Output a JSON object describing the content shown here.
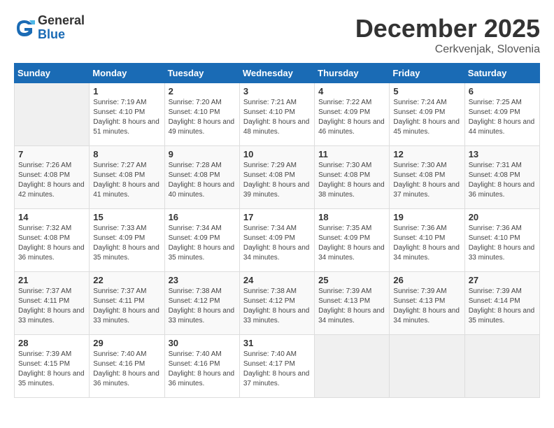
{
  "header": {
    "logo_general": "General",
    "logo_blue": "Blue",
    "month_title": "December 2025",
    "location": "Cerkvenjak, Slovenia"
  },
  "columns": [
    "Sunday",
    "Monday",
    "Tuesday",
    "Wednesday",
    "Thursday",
    "Friday",
    "Saturday"
  ],
  "weeks": [
    [
      {
        "day": "",
        "sunrise": "",
        "sunset": "",
        "daylight": ""
      },
      {
        "day": "1",
        "sunrise": "Sunrise: 7:19 AM",
        "sunset": "Sunset: 4:10 PM",
        "daylight": "Daylight: 8 hours and 51 minutes."
      },
      {
        "day": "2",
        "sunrise": "Sunrise: 7:20 AM",
        "sunset": "Sunset: 4:10 PM",
        "daylight": "Daylight: 8 hours and 49 minutes."
      },
      {
        "day": "3",
        "sunrise": "Sunrise: 7:21 AM",
        "sunset": "Sunset: 4:10 PM",
        "daylight": "Daylight: 8 hours and 48 minutes."
      },
      {
        "day": "4",
        "sunrise": "Sunrise: 7:22 AM",
        "sunset": "Sunset: 4:09 PM",
        "daylight": "Daylight: 8 hours and 46 minutes."
      },
      {
        "day": "5",
        "sunrise": "Sunrise: 7:24 AM",
        "sunset": "Sunset: 4:09 PM",
        "daylight": "Daylight: 8 hours and 45 minutes."
      },
      {
        "day": "6",
        "sunrise": "Sunrise: 7:25 AM",
        "sunset": "Sunset: 4:09 PM",
        "daylight": "Daylight: 8 hours and 44 minutes."
      }
    ],
    [
      {
        "day": "7",
        "sunrise": "Sunrise: 7:26 AM",
        "sunset": "Sunset: 4:08 PM",
        "daylight": "Daylight: 8 hours and 42 minutes."
      },
      {
        "day": "8",
        "sunrise": "Sunrise: 7:27 AM",
        "sunset": "Sunset: 4:08 PM",
        "daylight": "Daylight: 8 hours and 41 minutes."
      },
      {
        "day": "9",
        "sunrise": "Sunrise: 7:28 AM",
        "sunset": "Sunset: 4:08 PM",
        "daylight": "Daylight: 8 hours and 40 minutes."
      },
      {
        "day": "10",
        "sunrise": "Sunrise: 7:29 AM",
        "sunset": "Sunset: 4:08 PM",
        "daylight": "Daylight: 8 hours and 39 minutes."
      },
      {
        "day": "11",
        "sunrise": "Sunrise: 7:30 AM",
        "sunset": "Sunset: 4:08 PM",
        "daylight": "Daylight: 8 hours and 38 minutes."
      },
      {
        "day": "12",
        "sunrise": "Sunrise: 7:30 AM",
        "sunset": "Sunset: 4:08 PM",
        "daylight": "Daylight: 8 hours and 37 minutes."
      },
      {
        "day": "13",
        "sunrise": "Sunrise: 7:31 AM",
        "sunset": "Sunset: 4:08 PM",
        "daylight": "Daylight: 8 hours and 36 minutes."
      }
    ],
    [
      {
        "day": "14",
        "sunrise": "Sunrise: 7:32 AM",
        "sunset": "Sunset: 4:08 PM",
        "daylight": "Daylight: 8 hours and 36 minutes."
      },
      {
        "day": "15",
        "sunrise": "Sunrise: 7:33 AM",
        "sunset": "Sunset: 4:09 PM",
        "daylight": "Daylight: 8 hours and 35 minutes."
      },
      {
        "day": "16",
        "sunrise": "Sunrise: 7:34 AM",
        "sunset": "Sunset: 4:09 PM",
        "daylight": "Daylight: 8 hours and 35 minutes."
      },
      {
        "day": "17",
        "sunrise": "Sunrise: 7:34 AM",
        "sunset": "Sunset: 4:09 PM",
        "daylight": "Daylight: 8 hours and 34 minutes."
      },
      {
        "day": "18",
        "sunrise": "Sunrise: 7:35 AM",
        "sunset": "Sunset: 4:09 PM",
        "daylight": "Daylight: 8 hours and 34 minutes."
      },
      {
        "day": "19",
        "sunrise": "Sunrise: 7:36 AM",
        "sunset": "Sunset: 4:10 PM",
        "daylight": "Daylight: 8 hours and 34 minutes."
      },
      {
        "day": "20",
        "sunrise": "Sunrise: 7:36 AM",
        "sunset": "Sunset: 4:10 PM",
        "daylight": "Daylight: 8 hours and 33 minutes."
      }
    ],
    [
      {
        "day": "21",
        "sunrise": "Sunrise: 7:37 AM",
        "sunset": "Sunset: 4:11 PM",
        "daylight": "Daylight: 8 hours and 33 minutes."
      },
      {
        "day": "22",
        "sunrise": "Sunrise: 7:37 AM",
        "sunset": "Sunset: 4:11 PM",
        "daylight": "Daylight: 8 hours and 33 minutes."
      },
      {
        "day": "23",
        "sunrise": "Sunrise: 7:38 AM",
        "sunset": "Sunset: 4:12 PM",
        "daylight": "Daylight: 8 hours and 33 minutes."
      },
      {
        "day": "24",
        "sunrise": "Sunrise: 7:38 AM",
        "sunset": "Sunset: 4:12 PM",
        "daylight": "Daylight: 8 hours and 33 minutes."
      },
      {
        "day": "25",
        "sunrise": "Sunrise: 7:39 AM",
        "sunset": "Sunset: 4:13 PM",
        "daylight": "Daylight: 8 hours and 34 minutes."
      },
      {
        "day": "26",
        "sunrise": "Sunrise: 7:39 AM",
        "sunset": "Sunset: 4:13 PM",
        "daylight": "Daylight: 8 hours and 34 minutes."
      },
      {
        "day": "27",
        "sunrise": "Sunrise: 7:39 AM",
        "sunset": "Sunset: 4:14 PM",
        "daylight": "Daylight: 8 hours and 35 minutes."
      }
    ],
    [
      {
        "day": "28",
        "sunrise": "Sunrise: 7:39 AM",
        "sunset": "Sunset: 4:15 PM",
        "daylight": "Daylight: 8 hours and 35 minutes."
      },
      {
        "day": "29",
        "sunrise": "Sunrise: 7:40 AM",
        "sunset": "Sunset: 4:16 PM",
        "daylight": "Daylight: 8 hours and 36 minutes."
      },
      {
        "day": "30",
        "sunrise": "Sunrise: 7:40 AM",
        "sunset": "Sunset: 4:16 PM",
        "daylight": "Daylight: 8 hours and 36 minutes."
      },
      {
        "day": "31",
        "sunrise": "Sunrise: 7:40 AM",
        "sunset": "Sunset: 4:17 PM",
        "daylight": "Daylight: 8 hours and 37 minutes."
      },
      {
        "day": "",
        "sunrise": "",
        "sunset": "",
        "daylight": ""
      },
      {
        "day": "",
        "sunrise": "",
        "sunset": "",
        "daylight": ""
      },
      {
        "day": "",
        "sunrise": "",
        "sunset": "",
        "daylight": ""
      }
    ]
  ]
}
